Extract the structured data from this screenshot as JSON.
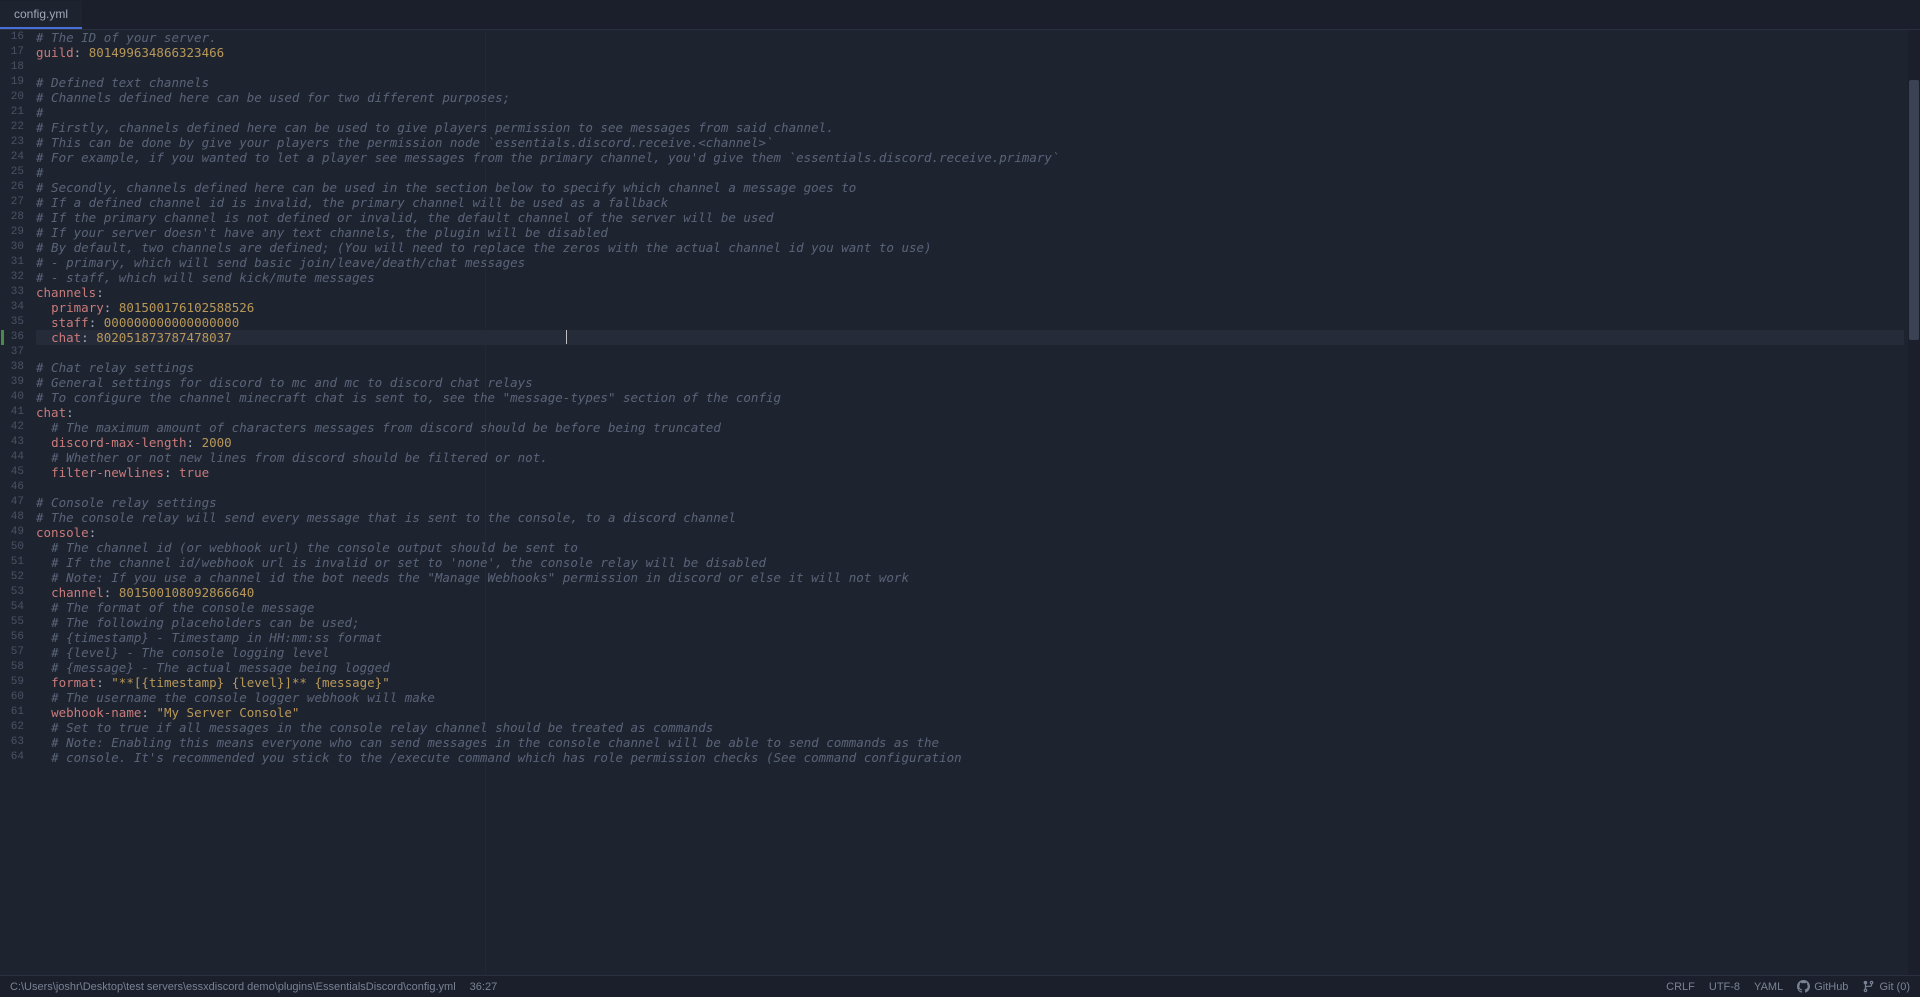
{
  "tab": {
    "filename": "config.yml"
  },
  "editor": {
    "startLine": 16,
    "activeLine": 36,
    "cursorCol": 27,
    "lines": [
      {
        "num": 16,
        "tokens": [
          {
            "type": "comment",
            "text": "# The ID of your server."
          }
        ]
      },
      {
        "num": 17,
        "tokens": [
          {
            "type": "yaml-key",
            "text": "guild"
          },
          {
            "type": "yaml-colon",
            "text": ": "
          },
          {
            "type": "yaml-value",
            "text": "801499634866323466"
          }
        ]
      },
      {
        "num": 18,
        "tokens": []
      },
      {
        "num": 19,
        "tokens": [
          {
            "type": "comment",
            "text": "# Defined text channels"
          }
        ]
      },
      {
        "num": 20,
        "tokens": [
          {
            "type": "comment",
            "text": "# Channels defined here can be used for two different purposes;"
          }
        ]
      },
      {
        "num": 21,
        "tokens": [
          {
            "type": "comment",
            "text": "#"
          }
        ]
      },
      {
        "num": 22,
        "tokens": [
          {
            "type": "comment",
            "text": "# Firstly, channels defined here can be used to give players permission to see messages from said channel."
          }
        ]
      },
      {
        "num": 23,
        "tokens": [
          {
            "type": "comment",
            "text": "# This can be done by give your players the permission node `essentials.discord.receive.<channel>`"
          }
        ]
      },
      {
        "num": 24,
        "tokens": [
          {
            "type": "comment",
            "text": "# For example, if you wanted to let a player see messages from the primary channel, you'd give them `essentials.discord.receive.primary`"
          }
        ]
      },
      {
        "num": 25,
        "tokens": [
          {
            "type": "comment",
            "text": "#"
          }
        ]
      },
      {
        "num": 26,
        "tokens": [
          {
            "type": "comment",
            "text": "# Secondly, channels defined here can be used in the section below to specify which channel a message goes to"
          }
        ]
      },
      {
        "num": 27,
        "tokens": [
          {
            "type": "comment",
            "text": "# If a defined channel id is invalid, the primary channel will be used as a fallback"
          }
        ]
      },
      {
        "num": 28,
        "tokens": [
          {
            "type": "comment",
            "text": "# If the primary channel is not defined or invalid, the default channel of the server will be used"
          }
        ]
      },
      {
        "num": 29,
        "tokens": [
          {
            "type": "comment",
            "text": "# If your server doesn't have any text channels, the plugin will be disabled"
          }
        ]
      },
      {
        "num": 30,
        "tokens": [
          {
            "type": "comment",
            "text": "# By default, two channels are defined; (You will need to replace the zeros with the actual channel id you want to use)"
          }
        ]
      },
      {
        "num": 31,
        "tokens": [
          {
            "type": "comment",
            "text": "# - primary, which will send basic join/leave/death/chat messages"
          }
        ]
      },
      {
        "num": 32,
        "tokens": [
          {
            "type": "comment",
            "text": "# - staff, which will send kick/mute messages"
          }
        ]
      },
      {
        "num": 33,
        "tokens": [
          {
            "type": "yaml-key",
            "text": "channels"
          },
          {
            "type": "yaml-colon",
            "text": ":"
          }
        ]
      },
      {
        "num": 34,
        "indent": 2,
        "tokens": [
          {
            "type": "yaml-key",
            "text": "primary"
          },
          {
            "type": "yaml-colon",
            "text": ": "
          },
          {
            "type": "yaml-value",
            "text": "801500176102588526"
          }
        ]
      },
      {
        "num": 35,
        "indent": 2,
        "tokens": [
          {
            "type": "yaml-key",
            "text": "staff"
          },
          {
            "type": "yaml-colon",
            "text": ": "
          },
          {
            "type": "yaml-value",
            "text": "000000000000000000"
          }
        ]
      },
      {
        "num": 36,
        "indent": 2,
        "active": true,
        "tokens": [
          {
            "type": "yaml-key",
            "text": "chat"
          },
          {
            "type": "yaml-colon",
            "text": ": "
          },
          {
            "type": "yaml-value",
            "text": "802051873787478037"
          }
        ]
      },
      {
        "num": 37,
        "tokens": []
      },
      {
        "num": 38,
        "tokens": [
          {
            "type": "comment",
            "text": "# Chat relay settings"
          }
        ]
      },
      {
        "num": 39,
        "tokens": [
          {
            "type": "comment",
            "text": "# General settings for discord to mc and mc to discord chat relays"
          }
        ]
      },
      {
        "num": 40,
        "tokens": [
          {
            "type": "comment",
            "text": "# To configure the channel minecraft chat is sent to, see the \"message-types\" section of the config"
          }
        ]
      },
      {
        "num": 41,
        "tokens": [
          {
            "type": "yaml-key",
            "text": "chat"
          },
          {
            "type": "yaml-colon",
            "text": ":"
          }
        ]
      },
      {
        "num": 42,
        "indent": 2,
        "tokens": [
          {
            "type": "comment",
            "text": "# The maximum amount of characters messages from discord should be before being truncated"
          }
        ]
      },
      {
        "num": 43,
        "indent": 2,
        "tokens": [
          {
            "type": "yaml-key",
            "text": "discord-max-length"
          },
          {
            "type": "yaml-colon",
            "text": ": "
          },
          {
            "type": "yaml-value",
            "text": "2000"
          }
        ]
      },
      {
        "num": 44,
        "indent": 2,
        "tokens": [
          {
            "type": "comment",
            "text": "# Whether or not new lines from discord should be filtered or not."
          }
        ]
      },
      {
        "num": 45,
        "indent": 2,
        "tokens": [
          {
            "type": "yaml-key",
            "text": "filter-newlines"
          },
          {
            "type": "yaml-colon",
            "text": ": "
          },
          {
            "type": "yaml-bool",
            "text": "true"
          }
        ]
      },
      {
        "num": 46,
        "tokens": []
      },
      {
        "num": 47,
        "tokens": [
          {
            "type": "comment",
            "text": "# Console relay settings"
          }
        ]
      },
      {
        "num": 48,
        "tokens": [
          {
            "type": "comment",
            "text": "# The console relay will send every message that is sent to the console, to a discord channel"
          }
        ]
      },
      {
        "num": 49,
        "tokens": [
          {
            "type": "yaml-key",
            "text": "console"
          },
          {
            "type": "yaml-colon",
            "text": ":"
          }
        ]
      },
      {
        "num": 50,
        "indent": 2,
        "tokens": [
          {
            "type": "comment",
            "text": "# The channel id (or webhook url) the console output should be sent to"
          }
        ]
      },
      {
        "num": 51,
        "indent": 2,
        "tokens": [
          {
            "type": "comment",
            "text": "# If the channel id/webhook url is invalid or set to 'none', the console relay will be disabled"
          }
        ]
      },
      {
        "num": 52,
        "indent": 2,
        "tokens": [
          {
            "type": "comment",
            "text": "# Note: If you use a channel id the bot needs the \"Manage Webhooks\" permission in discord or else it will not work"
          }
        ]
      },
      {
        "num": 53,
        "indent": 2,
        "tokens": [
          {
            "type": "yaml-key",
            "text": "channel"
          },
          {
            "type": "yaml-colon",
            "text": ": "
          },
          {
            "type": "yaml-value",
            "text": "801500108092866640"
          }
        ]
      },
      {
        "num": 54,
        "indent": 2,
        "tokens": [
          {
            "type": "comment",
            "text": "# The format of the console message"
          }
        ]
      },
      {
        "num": 55,
        "indent": 2,
        "tokens": [
          {
            "type": "comment",
            "text": "# The following placeholders can be used;"
          }
        ]
      },
      {
        "num": 56,
        "indent": 2,
        "tokens": [
          {
            "type": "comment",
            "text": "# {timestamp} - Timestamp in HH:mm:ss format"
          }
        ]
      },
      {
        "num": 57,
        "indent": 2,
        "tokens": [
          {
            "type": "comment",
            "text": "# {level} - The console logging level"
          }
        ]
      },
      {
        "num": 58,
        "indent": 2,
        "tokens": [
          {
            "type": "comment",
            "text": "# {message} - The actual message being logged"
          }
        ]
      },
      {
        "num": 59,
        "indent": 2,
        "tokens": [
          {
            "type": "yaml-key",
            "text": "format"
          },
          {
            "type": "yaml-colon",
            "text": ": "
          },
          {
            "type": "yaml-value",
            "text": "\"**[{timestamp} {level}]** {message}\""
          }
        ]
      },
      {
        "num": 60,
        "indent": 2,
        "tokens": [
          {
            "type": "comment",
            "text": "# The username the console logger webhook will make"
          }
        ]
      },
      {
        "num": 61,
        "indent": 2,
        "tokens": [
          {
            "type": "yaml-key",
            "text": "webhook-name"
          },
          {
            "type": "yaml-colon",
            "text": ": "
          },
          {
            "type": "yaml-value",
            "text": "\"My Server Console\""
          }
        ]
      },
      {
        "num": 62,
        "indent": 2,
        "tokens": [
          {
            "type": "comment",
            "text": "# Set to true if all messages in the console relay channel should be treated as commands"
          }
        ]
      },
      {
        "num": 63,
        "indent": 2,
        "tokens": [
          {
            "type": "comment",
            "text": "# Note: Enabling this means everyone who can send messages in the console channel will be able to send commands as the"
          }
        ]
      },
      {
        "num": 64,
        "indent": 2,
        "tokens": [
          {
            "type": "comment",
            "text": "# console. It's recommended you stick to the /execute command which has role permission checks (See command configuration"
          }
        ]
      }
    ]
  },
  "statusBar": {
    "path": "C:\\Users\\joshr\\Desktop\\test servers\\essxdiscord demo\\plugins\\EssentialsDiscord\\config.yml",
    "cursor": "36:27",
    "crlf": "CRLF",
    "encoding": "UTF-8",
    "language": "YAML",
    "github": "GitHub",
    "git": "Git (0)"
  }
}
